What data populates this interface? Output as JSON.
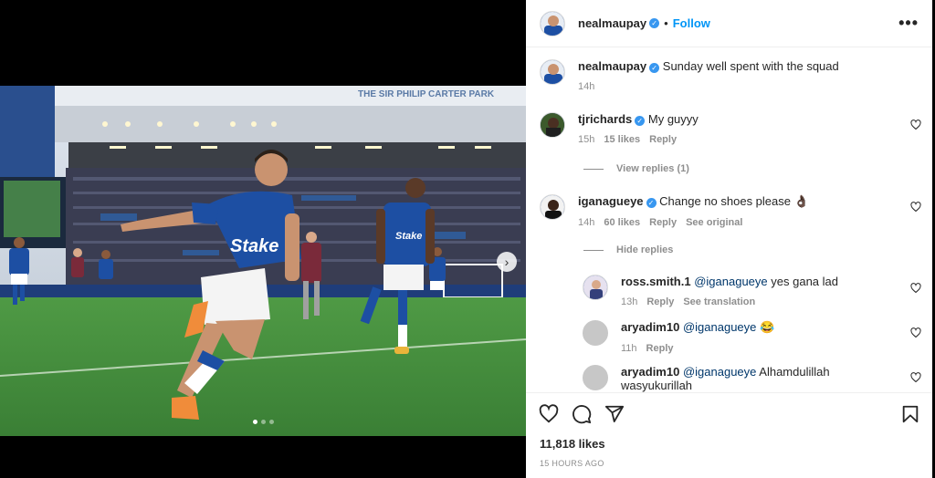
{
  "post": {
    "author": "nealmaupay",
    "follow_label": "Follow",
    "separator": "•",
    "more": "•••",
    "caption_author": "nealmaupay",
    "caption": "Sunday well spent with the squad",
    "caption_time": "14h",
    "likes": "11,818 likes",
    "posted": "15 HOURS AGO",
    "image_sign": "THE SIR PHILIP CARTER PARK",
    "slide_count": 3,
    "active_slide": 1
  },
  "comments": [
    {
      "user": "tjrichards",
      "text": "My guyyy",
      "time": "15h",
      "likes": "15 likes",
      "reply": "Reply"
    },
    {
      "user": "iganagueye",
      "text": "Change no shoes please 👌🏿",
      "time": "14h",
      "likes": "60 likes",
      "reply": "Reply",
      "extra": "See original"
    }
  ],
  "view_replies": "View replies (1)",
  "hide_replies": "Hide replies",
  "replies": [
    {
      "user": "ross.smith.1",
      "mention": "@iganagueye",
      "text": " yes gana lad",
      "time": "13h",
      "reply": "Reply",
      "extra": "See translation"
    },
    {
      "user": "aryadim10",
      "mention": "@iganagueye",
      "text": " 😂",
      "time": "11h",
      "reply": "Reply"
    },
    {
      "user": "aryadim10",
      "mention": "@iganagueye",
      "text": " Alhamdulillah wasyukurillah"
    }
  ],
  "colors": {
    "link": "#0095f6",
    "verified": "#3897f0",
    "everton_blue": "#1d4fa3",
    "pitch": "#3f8a3c"
  },
  "icons": [
    "verified-icon",
    "heart-icon",
    "comment-icon",
    "share-icon",
    "bookmark-icon",
    "chevron-right-icon"
  ]
}
